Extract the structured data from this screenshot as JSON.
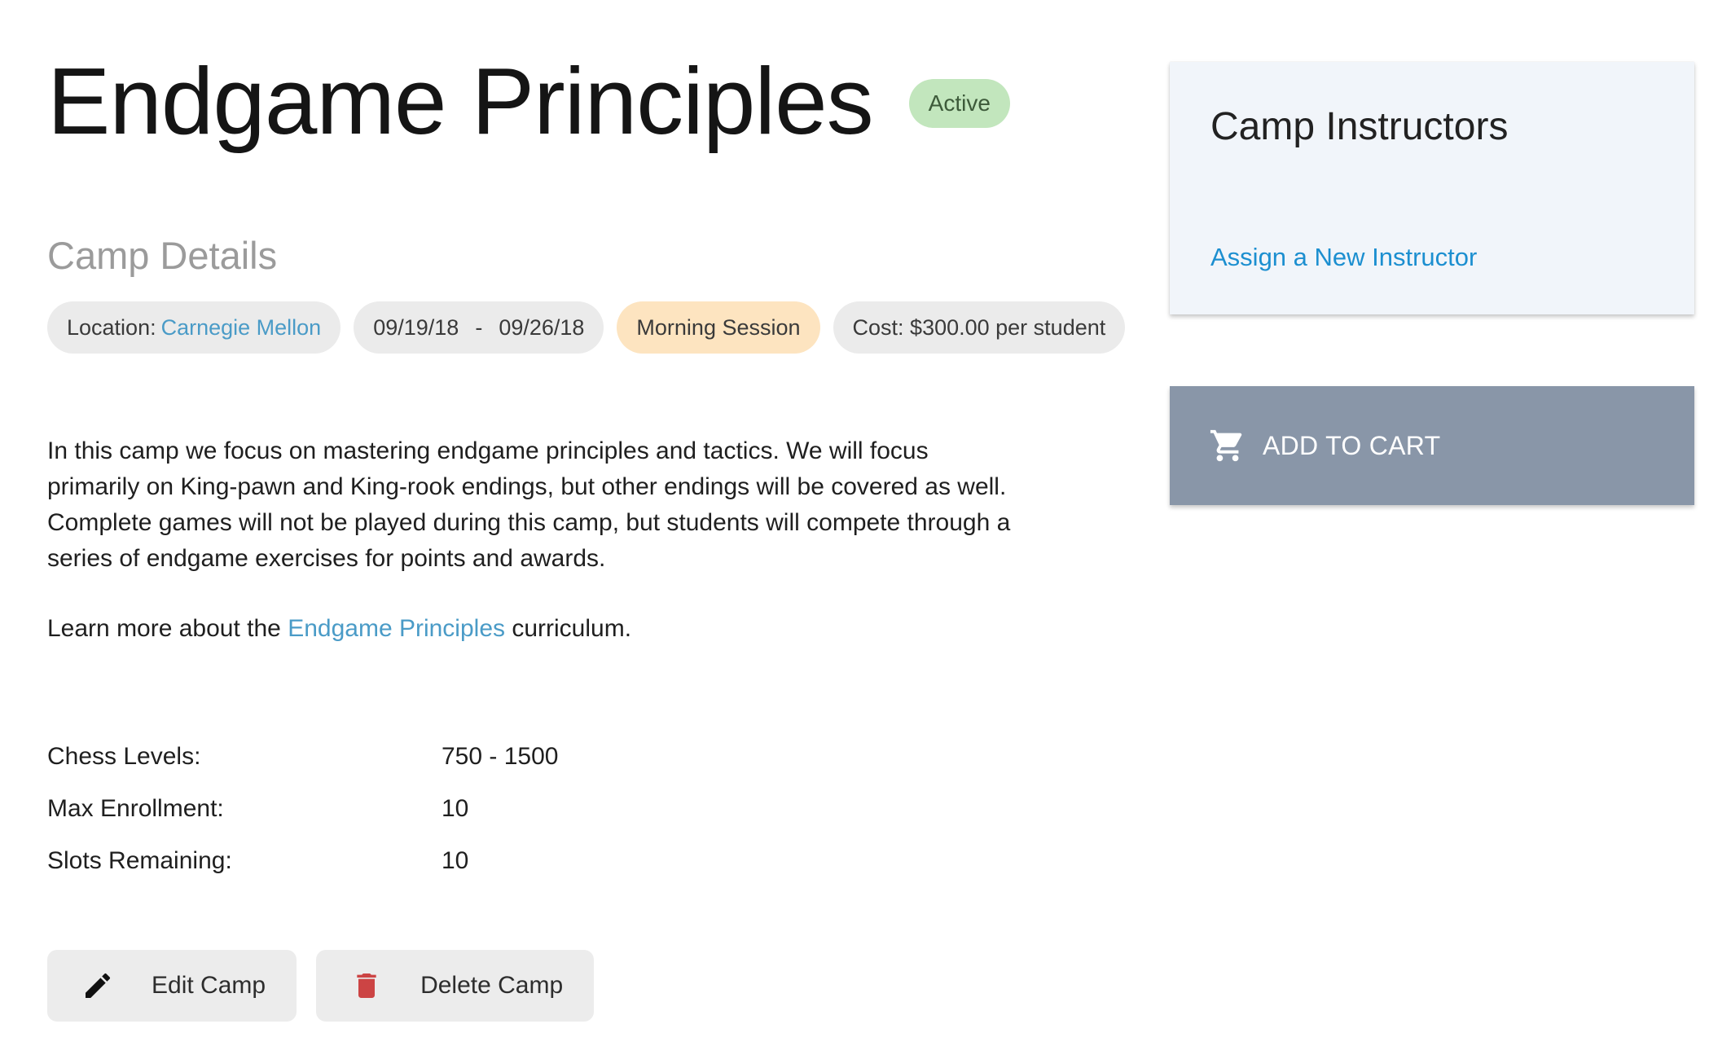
{
  "header": {
    "title": "Endgame Principles",
    "status": "Active"
  },
  "details": {
    "heading": "Camp Details",
    "location_label": "Location:",
    "location_value": "Carnegie Mellon",
    "start_date": "09/19/18",
    "date_separator": "-",
    "end_date": "09/26/18",
    "session": "Morning Session",
    "cost": "Cost: $300.00 per student"
  },
  "description": "In this camp we focus on mastering endgame principles and tactics. We will focus primarily on King-pawn and King-rook endings, but other endings will be covered as well. Complete games will not be played during this camp, but students will compete through a series of endgame exercises for points and awards.",
  "learn_more": {
    "prefix": "Learn more about the ",
    "link_text": "Endgame Principles",
    "suffix": " curriculum."
  },
  "info": [
    {
      "label": "Chess Levels:",
      "value": "750 - 1500"
    },
    {
      "label": "Max Enrollment:",
      "value": "10"
    },
    {
      "label": "Slots Remaining:",
      "value": "10"
    }
  ],
  "actions": {
    "edit_label": "Edit Camp",
    "delete_label": "Delete Camp",
    "edit_icon": "pencil-icon",
    "delete_icon": "trash-icon"
  },
  "instructors": {
    "title": "Camp Instructors",
    "assign_link": "Assign a New Instructor"
  },
  "cart": {
    "label": "ADD TO CART",
    "icon": "cart-icon"
  },
  "colors": {
    "link": "#4a9bc7",
    "assign_link": "#1c8fd0",
    "status_badge_bg": "#c2e6bd",
    "session_chip_bg": "#fde4c0",
    "chip_bg": "#ebebeb",
    "card_bg": "#f1f5fa",
    "cart_button_bg": "#8996a8",
    "delete_icon": "#cc4444"
  }
}
